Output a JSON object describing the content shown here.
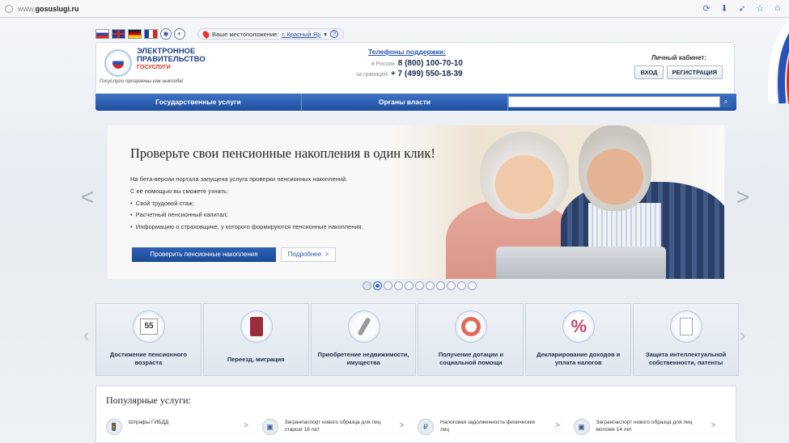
{
  "browser": {
    "url_prefix": "www.",
    "url_host": "gosuslugi.ru",
    "icons": [
      "reload-icon",
      "download-icon",
      "send-icon",
      "star-icon",
      "home-icon"
    ]
  },
  "header": {
    "location_label": "Ваше местоположение:",
    "location_value": "г. Красный Яр",
    "location_dropdown": "▾",
    "help": "?",
    "logo_line1": "ЭЛЕКТРОННОЕ",
    "logo_line2": "ПРАВИТЕЛЬСТВО",
    "logo_sub": "ГОСУСЛУГИ",
    "slogan": "Госуслуги прозрачны как никогда!",
    "phones_title": "Телефоны поддержки:",
    "phone_ru_label": "в России",
    "phone_ru": "8 (800) 100-70-10",
    "phone_abroad_label": "за границей",
    "phone_abroad": "+ 7 (499) 550-18-39",
    "cabinet_title": "Личный кабинет:",
    "login_label": "ВХОД",
    "register_label": "РЕГИСТРАЦИЯ"
  },
  "nav": {
    "items": [
      "Государственные услуги",
      "Органы власти"
    ],
    "search_placeholder": "",
    "search_icon": "🔍"
  },
  "hero": {
    "title": "Проверьте свои пенсионные накопления в один клик!",
    "line1": "На бета-версии портала запущена услуга проверки пенсионных накоплений.",
    "line2": "С её помощью вы сможете узнать:",
    "bullets": [
      "Свой трудовой стаж;",
      "Расчетный пенсионный капитал;",
      "Информацию о страховщике, у которого формируются пенсионные накопления."
    ],
    "cta": "Проверить пенсионные накопления",
    "more": "Подробнее",
    "more_chev": ">",
    "prev": "<",
    "next": ">"
  },
  "carousel": {
    "slide_count": 11,
    "active_index": 1
  },
  "tiles": [
    {
      "label": "Достижение пенсионного возраста",
      "icon": "calendar-55-icon",
      "glyph": "55"
    },
    {
      "label": "Переезд, миграция",
      "icon": "passport-icon",
      "glyph": ""
    },
    {
      "label": "Приобретение недвижимости, имущества",
      "icon": "keys-icon",
      "glyph": ""
    },
    {
      "label": "Получение дотации и социальной помощи",
      "icon": "lifebuoy-icon",
      "glyph": ""
    },
    {
      "label": "Декларирование доходов и уплата налогов",
      "icon": "percent-icon",
      "glyph": "%"
    },
    {
      "label": "Защита интеллектуальной собственности, патенты",
      "icon": "certificate-icon",
      "glyph": ""
    }
  ],
  "popular": {
    "title": "Популярные услуги:",
    "items": [
      {
        "label": "Штрафы ГИБДД",
        "icon": "traffic-light-icon",
        "glyph": "🚦"
      },
      {
        "label": "Загранпаспорт нового образца для лиц старше 18 лет",
        "icon": "passport-icon",
        "glyph": "▣"
      },
      {
        "label": "Налоговая задолженность физических лиц",
        "icon": "tax-icon",
        "glyph": "₽"
      },
      {
        "label": "Загранпаспорт нового образца для лиц моложе 14 лет",
        "icon": "passport-icon",
        "glyph": "▣"
      }
    ],
    "chevron": ">"
  }
}
